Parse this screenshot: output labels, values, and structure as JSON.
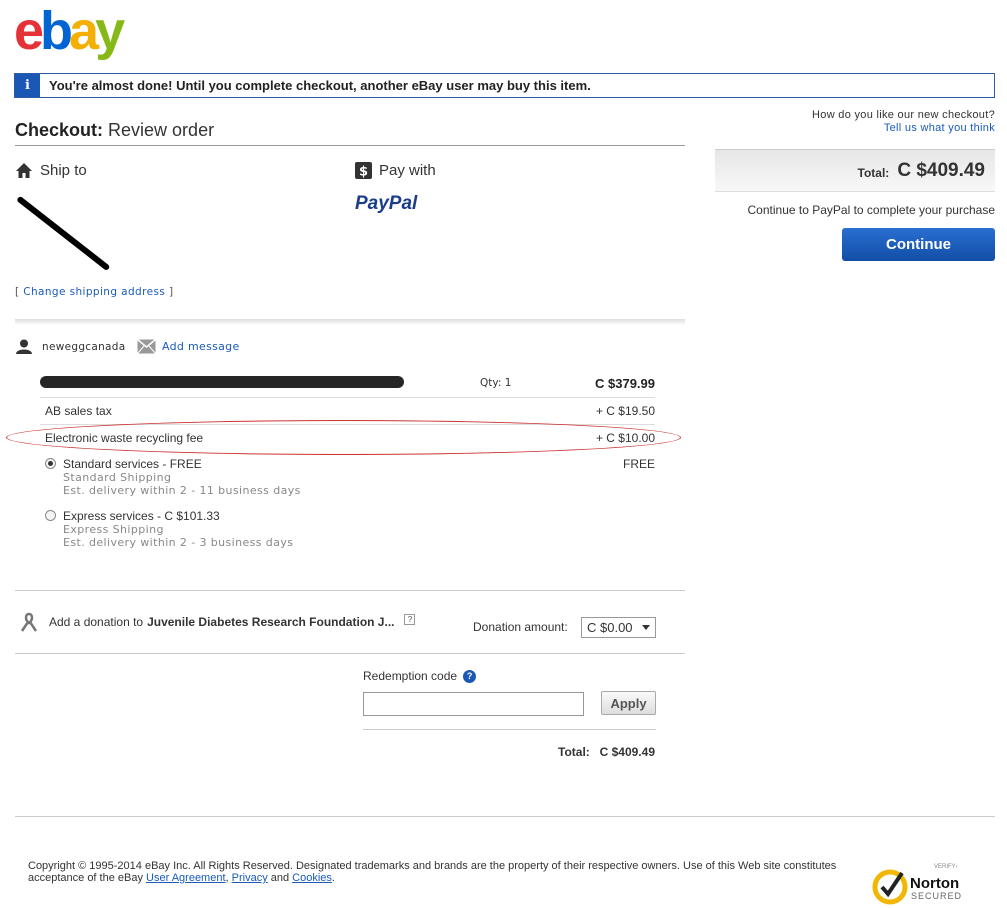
{
  "logo": {
    "e": "e",
    "b": "b",
    "a": "a",
    "y": "y",
    "colors": [
      "#e53238",
      "#0064d2",
      "#f5af02",
      "#86b817"
    ]
  },
  "alert": {
    "icon": "i",
    "text": "You're almost done! Until you complete checkout, another eBay user may buy this item."
  },
  "header": {
    "title_bold": "Checkout:",
    "title_rest": "Review order"
  },
  "feedback": {
    "question": "How do you like our new checkout?",
    "link": "Tell us what you think"
  },
  "ship_to": {
    "heading": "Ship to",
    "change_link": "Change shipping address",
    "bracket_open": "[",
    "bracket_close": "]"
  },
  "pay_with": {
    "heading": "Pay with",
    "method": "PayPal"
  },
  "seller": {
    "name": "neweggcanada",
    "add_message": "Add message"
  },
  "item": {
    "qty_label": "Qty: 1",
    "price": "C $379.99"
  },
  "fees": [
    {
      "label": "AB sales tax",
      "amount": "+ C $19.50"
    },
    {
      "label": "Electronic waste recycling fee",
      "amount": "+ C $10.00"
    }
  ],
  "shipping": [
    {
      "label": "Standard services - FREE",
      "service": "Standard Shipping",
      "delivery": "Est. delivery within 2 - 11 business days",
      "price": "FREE",
      "selected": true
    },
    {
      "label": "Express services - C $101.33",
      "service": "Express Shipping",
      "delivery": "Est. delivery within 2 - 3 business days",
      "price": "",
      "selected": false
    }
  ],
  "donation": {
    "prefix": "Add a donation to",
    "org": "Juvenile Diabetes Research Foundation J...",
    "help": "?",
    "amount_label": "Donation amount:",
    "amount_value": "C $0.00"
  },
  "redemption": {
    "label": "Redemption code",
    "help": "?",
    "apply": "Apply",
    "value": ""
  },
  "order_total": {
    "label": "Total:",
    "value": "C $409.49"
  },
  "sidebar": {
    "total_label": "Total:",
    "total_value": "C $409.49",
    "note": "Continue to PayPal to complete your purchase",
    "continue": "Continue"
  },
  "footer": {
    "text1": "Copyright © 1995-2014 eBay Inc. All Rights Reserved. Designated trademarks and brands are the property of their respective owners. Use of this Web site constitutes acceptance of the eBay ",
    "user_agreement": "User Agreement",
    "comma": ",",
    "privacy": "Privacy",
    "and": " and ",
    "cookies": "Cookies",
    "period": "."
  },
  "norton": {
    "verify": "VERIFY›",
    "name": "Norton",
    "secured": "SECURED"
  }
}
